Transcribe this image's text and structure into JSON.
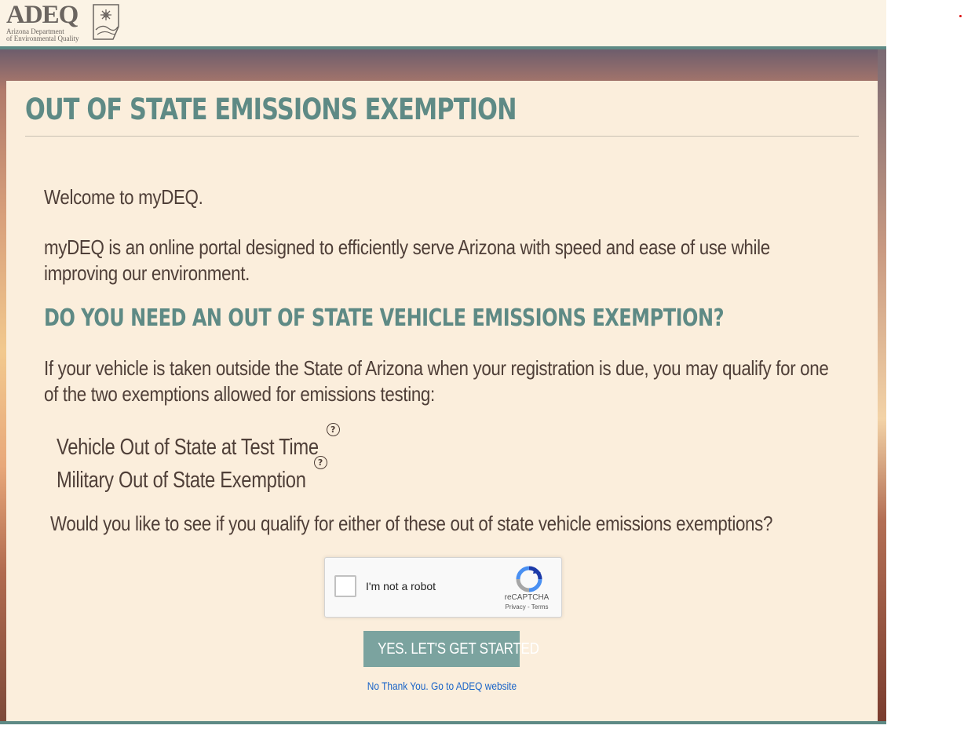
{
  "header": {
    "logo_text": "ADEQ",
    "logo_sub_line1": "Arizona Department",
    "logo_sub_line2": "of Environmental Quality"
  },
  "main": {
    "title": "OUT OF STATE EMISSIONS EXEMPTION",
    "welcome": "Welcome to myDEQ.",
    "intro": "myDEQ is an online portal designed to efficiently serve Arizona with speed and ease of use while improving our environment.",
    "subheading": "DO YOU NEED AN OUT OF STATE VEHICLE EMISSIONS EXEMPTION?",
    "qualify_text": "If your vehicle is taken outside the State of Arizona when your registration is due, you may qualify for one of the two exemptions allowed for emissions testing:",
    "exemptions": [
      {
        "label": "Vehicle Out of State at Test Time"
      },
      {
        "label": "Military Out of State Exemption"
      }
    ],
    "question": "Would you like to see if you qualify for either of these out of state vehicle emissions exemptions?",
    "help_icon_glyph": "?"
  },
  "recaptcha": {
    "label": "I'm not a robot",
    "brand": "reCAPTCHA",
    "privacy": "Privacy",
    "separator": "-",
    "terms": "Terms"
  },
  "actions": {
    "start_label": "YES. LET'S GET STARTED",
    "decline_label": "No Thank You. Go to ADEQ website"
  },
  "colors": {
    "accent": "#5e8a85",
    "button": "#7ba39f",
    "card_bg": "#fbeedc",
    "text": "#4f3f38",
    "link": "#1a64c8"
  }
}
